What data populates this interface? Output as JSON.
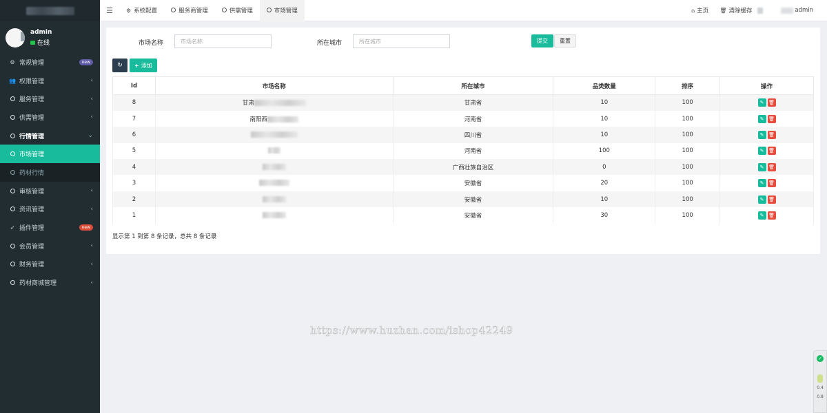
{
  "sidebar": {
    "user": {
      "name": "admin",
      "status": "在线"
    },
    "menu": [
      {
        "label": "常规管理",
        "icon": "cogs-icon",
        "badge": "new"
      },
      {
        "label": "权限管理",
        "icon": "users-icon"
      },
      {
        "label": "服务管理",
        "icon": "circle-icon"
      },
      {
        "label": "供需管理",
        "icon": "circle-icon"
      },
      {
        "label": "行情管理",
        "icon": "circle-icon"
      },
      {
        "label": "市场管理",
        "icon": "circle-icon"
      },
      {
        "label": "药材行情",
        "icon": "circle-icon"
      },
      {
        "label": "审核管理",
        "icon": "circle-icon"
      },
      {
        "label": "资讯管理",
        "icon": "circle-icon"
      },
      {
        "label": "插件管理",
        "icon": "rocket-icon",
        "badge": "new"
      },
      {
        "label": "会员管理",
        "icon": "circle-icon"
      },
      {
        "label": "财务管理",
        "icon": "circle-icon"
      },
      {
        "label": "药材商城管理",
        "icon": "circle-icon"
      }
    ]
  },
  "navbar": {
    "tabs": [
      "系统配置",
      "服务商管理",
      "供需管理",
      "市场管理"
    ],
    "home": "主页",
    "clear_cache": "清除缓存",
    "user": "admin"
  },
  "filters": {
    "market_label": "市场名称",
    "market_placeholder": "市场名称",
    "city_label": "所在城市",
    "city_placeholder": "所在城市",
    "submit": "提交",
    "reset": "重置"
  },
  "toolbar": {
    "add": "添加"
  },
  "table": {
    "headers": [
      "Id",
      "市场名称",
      "所在城市",
      "品类数量",
      "排序",
      "操作"
    ],
    "rows": [
      {
        "id": "8",
        "name_prefix": "甘肃",
        "city": "甘肃省",
        "count": "10",
        "sort": "100"
      },
      {
        "id": "7",
        "name_prefix": "南阳西",
        "city": "河南省",
        "count": "10",
        "sort": "100"
      },
      {
        "id": "6",
        "name_prefix": "",
        "city": "四川省",
        "count": "10",
        "sort": "100"
      },
      {
        "id": "5",
        "name_prefix": "",
        "city": "河南省",
        "count": "100",
        "sort": "100"
      },
      {
        "id": "4",
        "name_prefix": "",
        "city": "广西壮族自治区",
        "count": "0",
        "sort": "100"
      },
      {
        "id": "3",
        "name_prefix": "",
        "city": "安徽省",
        "count": "20",
        "sort": "100"
      },
      {
        "id": "2",
        "name_prefix": "",
        "city": "安徽省",
        "count": "10",
        "sort": "100"
      },
      {
        "id": "1",
        "name_prefix": "",
        "city": "安徽省",
        "count": "30",
        "sort": "100"
      }
    ]
  },
  "summary": "显示第 1 到第 8 条记录，总共 8 条记录",
  "watermark": "https://www.huzhan.com/ishop42249",
  "widget": {
    "value1": "0.4",
    "value2": "0.8"
  },
  "colors": {
    "primary": "#18bc9c",
    "danger": "#e74c3c",
    "sidebar_bg": "#222d32",
    "dark_button": "#2c3e50"
  }
}
